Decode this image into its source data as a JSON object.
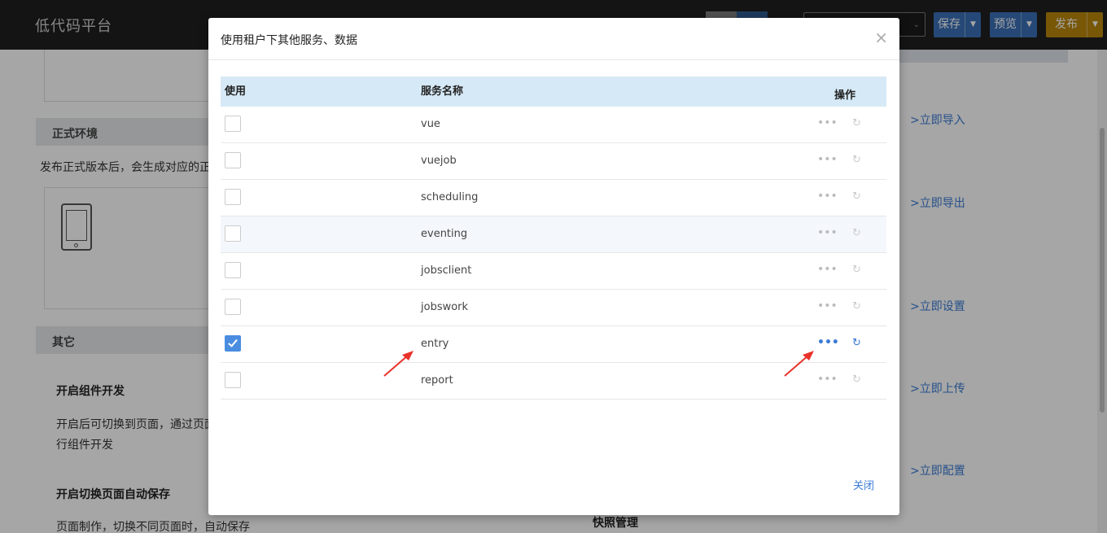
{
  "app": {
    "title": "低代码平台"
  },
  "toolbar": {
    "save_label": "保存",
    "preview_label": "预览",
    "publish_label": "发布",
    "dropdown_arrow": "▼",
    "select_caret": "⌄"
  },
  "background": {
    "section_formal": "正式环境",
    "formal_desc": "发布正式版本后，会生成对应的正",
    "section_other": "其它",
    "dev_heading": "开启组件开发",
    "dev_text_1": "开启后可切换到页面，通过页面",
    "dev_text_2": "行组件开发",
    "autosave_heading": "开启切换页面自动保存",
    "autosave_text": "页面制作，切换不同页面时，自动保存",
    "snapshot_heading": "快照管理",
    "links": [
      "&gt;立即导入",
      "&gt;立即导出",
      "&gt;立即设置",
      "&gt;立即上传",
      "&gt;立即配置"
    ]
  },
  "modal": {
    "title": "使用租户下其他服务、数据",
    "close_icon": "×",
    "columns": {
      "use": "使用",
      "name": "服务名称",
      "op": "操作"
    },
    "rows": [
      {
        "name": "vue",
        "checked": false
      },
      {
        "name": "vuejob",
        "checked": false
      },
      {
        "name": "scheduling",
        "checked": false
      },
      {
        "name": "eventing",
        "checked": false
      },
      {
        "name": "jobsclient",
        "checked": false
      },
      {
        "name": "jobswork",
        "checked": false
      },
      {
        "name": "entry",
        "checked": true
      },
      {
        "name": "report",
        "checked": false
      }
    ],
    "more_icon": "•••",
    "refresh_icon": "↻",
    "footer_close": "关闭"
  },
  "colors": {
    "accent": "#3a7bd5",
    "publish": "#b9860c",
    "header_bg": "#d6e9f6",
    "annotation": "#e8322a"
  }
}
